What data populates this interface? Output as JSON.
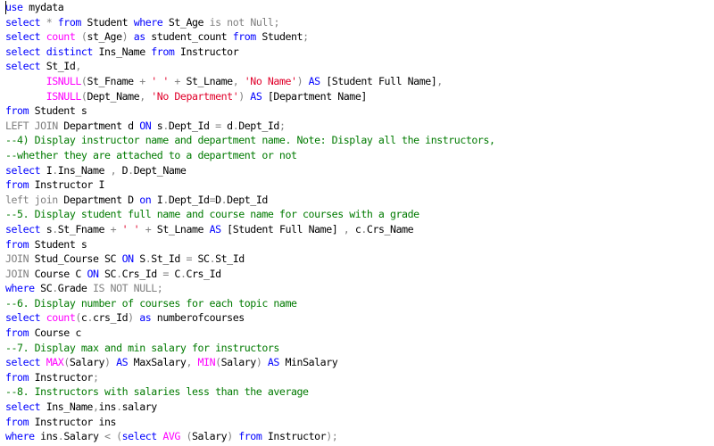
{
  "editor": {
    "colors": {
      "keyword": "#0000ff",
      "plain": "#000000",
      "string": "#e0002a",
      "comment": "#007a00",
      "function": "#ff00ff",
      "operator": "#808080",
      "background": "#ffffff"
    },
    "lines": [
      [
        [
          "kw",
          "use"
        ],
        [
          "plain",
          " mydata"
        ]
      ],
      [
        [
          "kw",
          "select"
        ],
        [
          "plain",
          " "
        ],
        [
          "gray",
          "*"
        ],
        [
          "plain",
          " "
        ],
        [
          "kw",
          "from"
        ],
        [
          "plain",
          " Student "
        ],
        [
          "kw",
          "where"
        ],
        [
          "plain",
          " St_Age "
        ],
        [
          "gray",
          "is not"
        ],
        [
          "plain",
          " "
        ],
        [
          "gray",
          "Null"
        ],
        [
          "gray",
          ";"
        ]
      ],
      [
        [
          "kw",
          "select"
        ],
        [
          "plain",
          " "
        ],
        [
          "fn",
          "count"
        ],
        [
          "plain",
          " "
        ],
        [
          "gray",
          "("
        ],
        [
          "plain",
          "st_Age"
        ],
        [
          "gray",
          ")"
        ],
        [
          "plain",
          " "
        ],
        [
          "kw",
          "as"
        ],
        [
          "plain",
          " student_count "
        ],
        [
          "kw",
          "from"
        ],
        [
          "plain",
          " Student"
        ],
        [
          "gray",
          ";"
        ]
      ],
      [
        [
          "kw",
          "select distinct"
        ],
        [
          "plain",
          " Ins_Name "
        ],
        [
          "kw",
          "from"
        ],
        [
          "plain",
          " Instructor"
        ]
      ],
      [
        [
          "kw",
          "select"
        ],
        [
          "plain",
          " St_Id"
        ],
        [
          "gray",
          ","
        ]
      ],
      [
        [
          "plain",
          "       "
        ],
        [
          "fn",
          "ISNULL"
        ],
        [
          "gray",
          "("
        ],
        [
          "plain",
          "St_Fname "
        ],
        [
          "gray",
          "+"
        ],
        [
          "plain",
          " "
        ],
        [
          "str",
          "' '"
        ],
        [
          "plain",
          " "
        ],
        [
          "gray",
          "+"
        ],
        [
          "plain",
          " St_Lname"
        ],
        [
          "gray",
          ","
        ],
        [
          "plain",
          " "
        ],
        [
          "str",
          "'No Name'"
        ],
        [
          "gray",
          ")"
        ],
        [
          "plain",
          " "
        ],
        [
          "kw",
          "AS"
        ],
        [
          "plain",
          " [Student Full Name]"
        ],
        [
          "gray",
          ","
        ]
      ],
      [
        [
          "plain",
          "       "
        ],
        [
          "fn",
          "ISNULL"
        ],
        [
          "gray",
          "("
        ],
        [
          "plain",
          "Dept_Name"
        ],
        [
          "gray",
          ","
        ],
        [
          "plain",
          " "
        ],
        [
          "str",
          "'No Department'"
        ],
        [
          "gray",
          ")"
        ],
        [
          "plain",
          " "
        ],
        [
          "kw",
          "AS"
        ],
        [
          "plain",
          " [Department Name]"
        ]
      ],
      [
        [
          "kw",
          "from"
        ],
        [
          "plain",
          " Student s"
        ]
      ],
      [
        [
          "gray",
          "LEFT JOIN"
        ],
        [
          "plain",
          " Department d "
        ],
        [
          "kw",
          "ON"
        ],
        [
          "plain",
          " s"
        ],
        [
          "gray",
          "."
        ],
        [
          "plain",
          "Dept_Id "
        ],
        [
          "gray",
          "="
        ],
        [
          "plain",
          " d"
        ],
        [
          "gray",
          "."
        ],
        [
          "plain",
          "Dept_Id"
        ],
        [
          "gray",
          ";"
        ]
      ],
      [
        [
          "cmt",
          "--4) Display instructor name and department name. Note: Display all the instructors,"
        ]
      ],
      [
        [
          "cmt",
          "--whether they are attached to a department or not"
        ]
      ],
      [
        [
          "kw",
          "select"
        ],
        [
          "plain",
          " I"
        ],
        [
          "gray",
          "."
        ],
        [
          "plain",
          "Ins_Name "
        ],
        [
          "gray",
          ","
        ],
        [
          "plain",
          " D"
        ],
        [
          "gray",
          "."
        ],
        [
          "plain",
          "Dept_Name"
        ]
      ],
      [
        [
          "kw",
          "from"
        ],
        [
          "plain",
          " Instructor I"
        ]
      ],
      [
        [
          "gray",
          "left join"
        ],
        [
          "plain",
          " Department D "
        ],
        [
          "kw",
          "on"
        ],
        [
          "plain",
          " I"
        ],
        [
          "gray",
          "."
        ],
        [
          "plain",
          "Dept_Id"
        ],
        [
          "gray",
          "="
        ],
        [
          "plain",
          "D"
        ],
        [
          "gray",
          "."
        ],
        [
          "plain",
          "Dept_Id"
        ]
      ],
      [
        [
          "cmt",
          "--5. Display student full name and course name for courses with a grade"
        ]
      ],
      [
        [
          "kw",
          "select"
        ],
        [
          "plain",
          " s"
        ],
        [
          "gray",
          "."
        ],
        [
          "plain",
          "St_Fname "
        ],
        [
          "gray",
          "+"
        ],
        [
          "plain",
          " "
        ],
        [
          "str",
          "' '"
        ],
        [
          "plain",
          " "
        ],
        [
          "gray",
          "+"
        ],
        [
          "plain",
          " St_Lname "
        ],
        [
          "kw",
          "AS"
        ],
        [
          "plain",
          " [Student Full Name] "
        ],
        [
          "gray",
          ","
        ],
        [
          "plain",
          " c"
        ],
        [
          "gray",
          "."
        ],
        [
          "plain",
          "Crs_Name"
        ]
      ],
      [
        [
          "kw",
          "from"
        ],
        [
          "plain",
          " Student s"
        ]
      ],
      [
        [
          "gray",
          "JOIN"
        ],
        [
          "plain",
          " Stud_Course SC "
        ],
        [
          "kw",
          "ON"
        ],
        [
          "plain",
          " S"
        ],
        [
          "gray",
          "."
        ],
        [
          "plain",
          "St_Id "
        ],
        [
          "gray",
          "="
        ],
        [
          "plain",
          " SC"
        ],
        [
          "gray",
          "."
        ],
        [
          "plain",
          "St_Id"
        ]
      ],
      [
        [
          "gray",
          "JOIN"
        ],
        [
          "plain",
          " Course C "
        ],
        [
          "kw",
          "ON"
        ],
        [
          "plain",
          " SC"
        ],
        [
          "gray",
          "."
        ],
        [
          "plain",
          "Crs_Id "
        ],
        [
          "gray",
          "="
        ],
        [
          "plain",
          " C"
        ],
        [
          "gray",
          "."
        ],
        [
          "plain",
          "Crs_Id"
        ]
      ],
      [
        [
          "kw",
          "where"
        ],
        [
          "plain",
          " SC"
        ],
        [
          "gray",
          "."
        ],
        [
          "plain",
          "Grade "
        ],
        [
          "gray",
          "IS NOT NULL;"
        ]
      ],
      [
        [
          "cmt",
          "--6. Display number of courses for each topic name"
        ]
      ],
      [
        [
          "kw",
          "select"
        ],
        [
          "plain",
          " "
        ],
        [
          "fn",
          "count"
        ],
        [
          "gray",
          "("
        ],
        [
          "plain",
          "c"
        ],
        [
          "gray",
          "."
        ],
        [
          "plain",
          "crs_Id"
        ],
        [
          "gray",
          ")"
        ],
        [
          "plain",
          " "
        ],
        [
          "kw",
          "as"
        ],
        [
          "plain",
          " numberofcourses"
        ]
      ],
      [
        [
          "kw",
          "from"
        ],
        [
          "plain",
          " Course c"
        ]
      ],
      [
        [
          "cmt",
          "--7. Display max and min salary for instructors"
        ]
      ],
      [
        [
          "kw",
          "select"
        ],
        [
          "plain",
          " "
        ],
        [
          "fn",
          "MAX"
        ],
        [
          "gray",
          "("
        ],
        [
          "plain",
          "Salary"
        ],
        [
          "gray",
          ")"
        ],
        [
          "plain",
          " "
        ],
        [
          "kw",
          "AS"
        ],
        [
          "plain",
          " MaxSalary"
        ],
        [
          "gray",
          ","
        ],
        [
          "plain",
          " "
        ],
        [
          "fn",
          "MIN"
        ],
        [
          "gray",
          "("
        ],
        [
          "plain",
          "Salary"
        ],
        [
          "gray",
          ")"
        ],
        [
          "plain",
          " "
        ],
        [
          "kw",
          "AS"
        ],
        [
          "plain",
          " MinSalary"
        ]
      ],
      [
        [
          "kw",
          "from"
        ],
        [
          "plain",
          " Instructor"
        ],
        [
          "gray",
          ";"
        ]
      ],
      [
        [
          "cmt",
          "--8. Instructors with salaries less than the average"
        ]
      ],
      [
        [
          "kw",
          "select"
        ],
        [
          "plain",
          " Ins_Name"
        ],
        [
          "gray",
          ","
        ],
        [
          "plain",
          "ins"
        ],
        [
          "gray",
          "."
        ],
        [
          "plain",
          "salary"
        ]
      ],
      [
        [
          "kw",
          "from"
        ],
        [
          "plain",
          " Instructor ins"
        ]
      ],
      [
        [
          "kw",
          "where"
        ],
        [
          "plain",
          " ins"
        ],
        [
          "gray",
          "."
        ],
        [
          "plain",
          "Salary "
        ],
        [
          "gray",
          "<"
        ],
        [
          "plain",
          " "
        ],
        [
          "gray",
          "("
        ],
        [
          "kw",
          "select"
        ],
        [
          "plain",
          " "
        ],
        [
          "fn",
          "AVG"
        ],
        [
          "plain",
          " "
        ],
        [
          "gray",
          "("
        ],
        [
          "plain",
          "Salary"
        ],
        [
          "gray",
          ")"
        ],
        [
          "plain",
          " "
        ],
        [
          "kw",
          "from"
        ],
        [
          "plain",
          " Instructor"
        ],
        [
          "gray",
          ");"
        ]
      ]
    ]
  }
}
